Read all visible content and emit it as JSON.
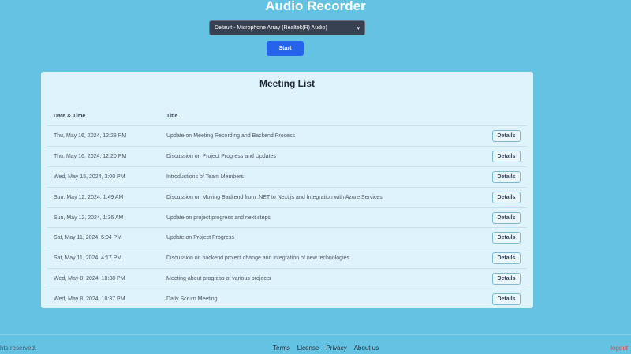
{
  "header": {
    "title": "Audio Recorder",
    "mic_select_value": "Default - Microphone Array (Realtek(R) Audio)",
    "start_label": "Start"
  },
  "meetings": {
    "heading": "Meeting List",
    "col_date": "Date & Time",
    "col_title": "Title",
    "details_label": "Details",
    "rows": [
      {
        "date": "Thu, May 16, 2024, 12:28 PM",
        "title": "Update on Meeting Recording and Backend Process"
      },
      {
        "date": "Thu, May 16, 2024, 12:20 PM",
        "title": "Discussion on Project Progress and Updates"
      },
      {
        "date": "Wed, May 15, 2024, 3:00 PM",
        "title": "Introductions of Team Members"
      },
      {
        "date": "Sun, May 12, 2024, 1:49 AM",
        "title": "Discussion on Moving Backend from .NET to Next.js and Integration with Azure Services"
      },
      {
        "date": "Sun, May 12, 2024, 1:36 AM",
        "title": "Update on project progress and next steps"
      },
      {
        "date": "Sat, May 11, 2024, 5:04 PM",
        "title": "Update on Project Progress"
      },
      {
        "date": "Sat, May 11, 2024, 4:17 PM",
        "title": "Discussion on backend project change and integration of new technologies"
      },
      {
        "date": "Wed, May 8, 2024, 10:38 PM",
        "title": "Meeting about progress of various projects"
      },
      {
        "date": "Wed, May 8, 2024, 10:37 PM",
        "title": "Daily Scrum Meeting"
      }
    ]
  },
  "footer": {
    "copyright": "hts reserved.",
    "links": [
      "Terms",
      "License",
      "Privacy",
      "About us"
    ],
    "logout": "logout"
  }
}
